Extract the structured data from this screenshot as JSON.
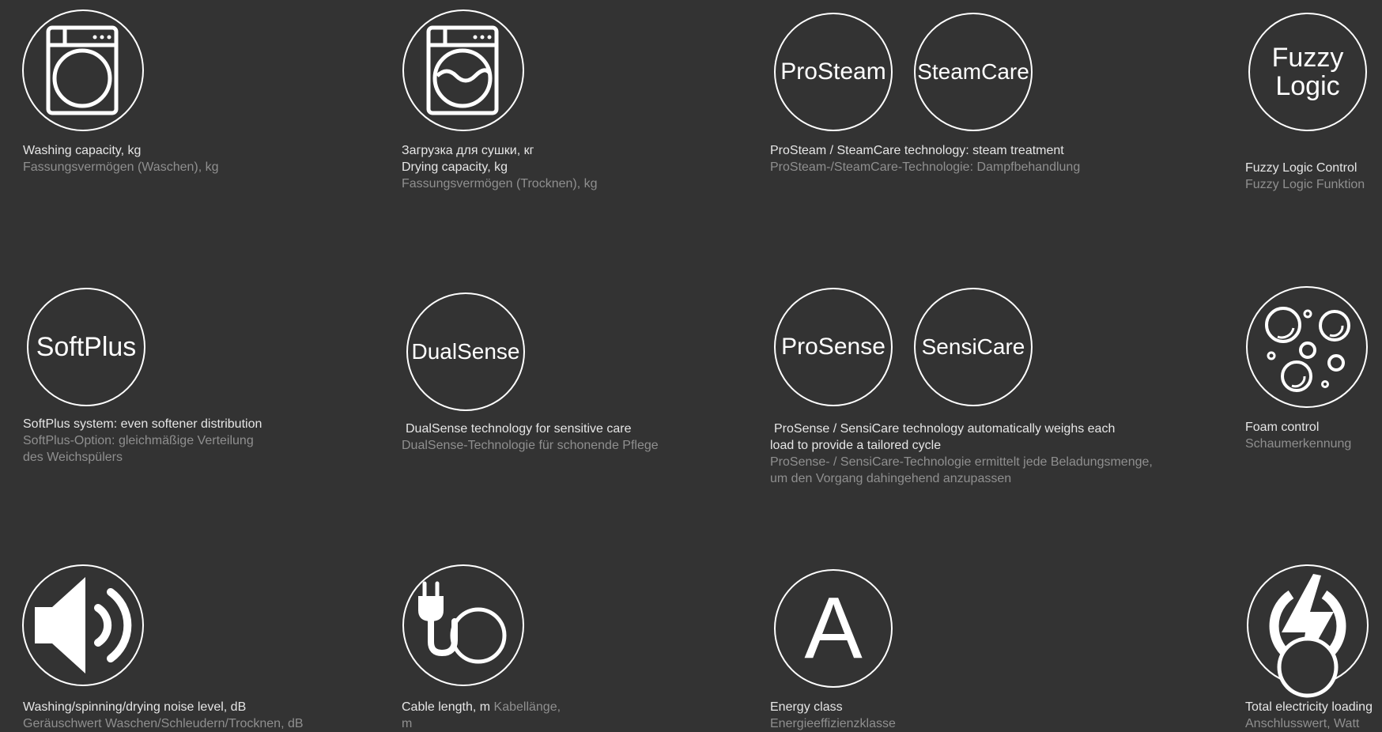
{
  "colors": {
    "background": "#333333",
    "icon_stroke": "#ffffff",
    "primary_text": "#e6e6e6",
    "secondary_text": "#8f8f8f"
  },
  "features": {
    "washing_capacity": {
      "icon": "washing-machine-icon",
      "line1": "Washing capacity, kg",
      "line2": "Fassungsvermögen (Waschen), kg"
    },
    "drying_capacity": {
      "icon": "washer-dryer-icon",
      "line1": "Загрузка для сушки, кг",
      "line2": "Drying capacity, kg",
      "line3": "Fassungsvermögen (Trocknen), kg"
    },
    "prosteam": {
      "badge1": "ProSteam",
      "badge2": "SteamCare",
      "line1": "ProSteam / SteamCare technology: steam treatment",
      "line2": "ProSteam-/SteamCare-Technologie: Dampfbehandlung"
    },
    "fuzzy_logic": {
      "badge_line1": "Fuzzy",
      "badge_line2": "Logic",
      "line1": "Fuzzy Logic Control",
      "line2": "Fuzzy Logic Funktion"
    },
    "softplus": {
      "badge": "SoftPlus",
      "line1": "SoftPlus system: even softener distribution",
      "line2": "SoftPlus-Option: gleichmäßige Verteilung",
      "line3": "des Weichspülers"
    },
    "dualsense": {
      "badge": "DualSense",
      "line1": "DualSense technology for sensitive care",
      "line2": "DualSense-Technologie für schonende Pflege"
    },
    "prosense": {
      "badge1": "ProSense",
      "badge2": "SensiCare",
      "line1": "ProSense / SensiCare technology automatically weighs each",
      "line2": "load to provide a tailored cycle",
      "line3": "ProSense- / SensiCare-Technologie ermittelt jede Beladungsmenge,",
      "line4": "um den Vorgang dahingehend anzupassen"
    },
    "foam_control": {
      "icon": "foam-bubbles-icon",
      "line1": "Foam control",
      "line2": "Schaumerkennung"
    },
    "noise_level": {
      "icon": "speaker-icon",
      "line1": "Washing/spinning/drying noise level, dB",
      "line2": "Geräuschwert Waschen/Schleudern/Trocknen, dB"
    },
    "cable_length": {
      "icon": "power-plug-icon",
      "line1": "Cable length, m",
      "line1_secondary": "Kabellänge,",
      "line2": "m"
    },
    "energy_class": {
      "badge": "A",
      "line1": "Energy class",
      "line2": "Energieeffizienzklasse"
    },
    "electricity": {
      "icon": "lightning-icon",
      "line1": "Total electricity loading",
      "line2": "Anschlusswert, Watt"
    }
  }
}
